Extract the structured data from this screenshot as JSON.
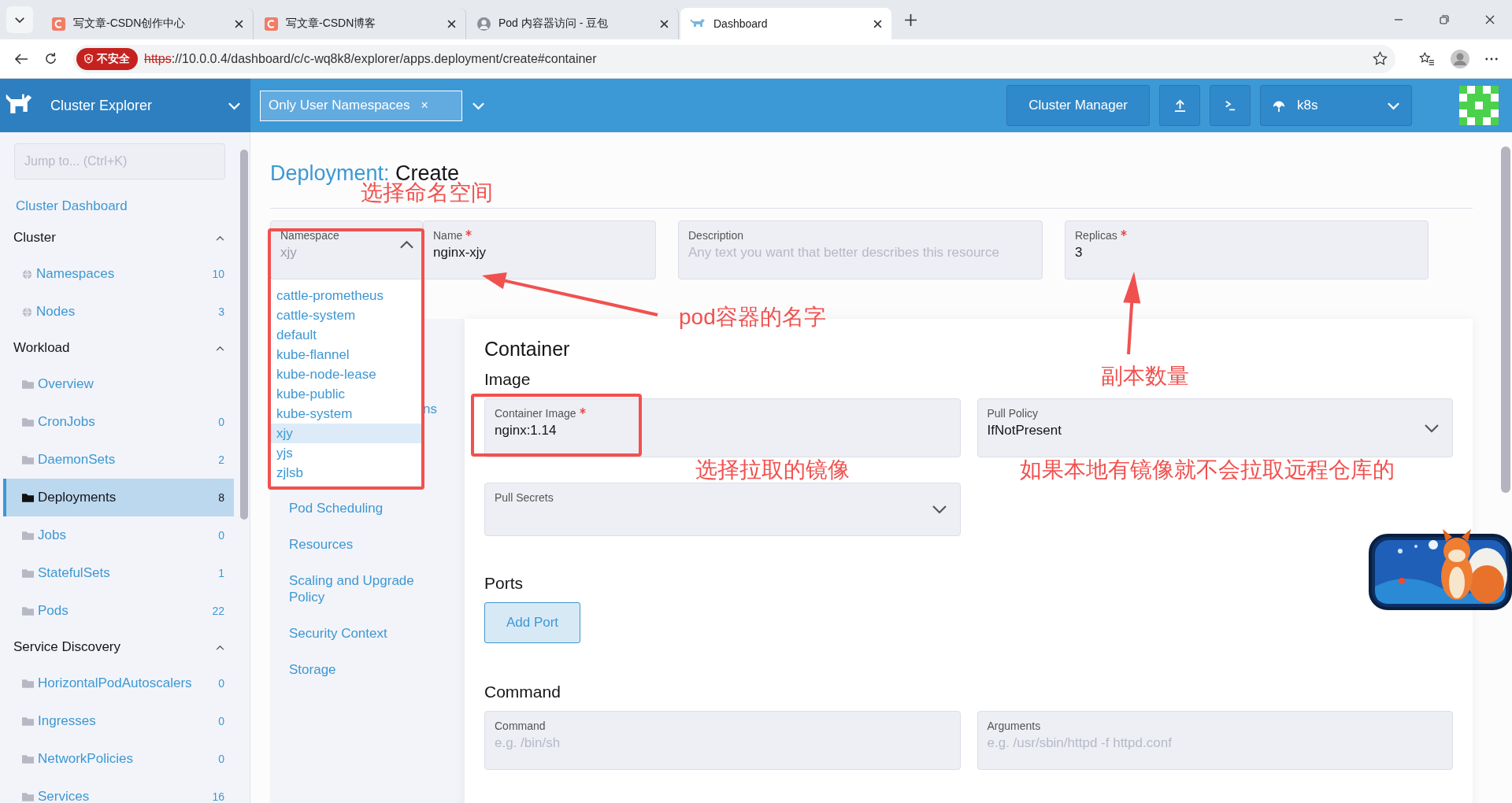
{
  "browser": {
    "tabs": [
      {
        "title": "写文章-CSDN创作中心",
        "selected": false,
        "kind": "csdn"
      },
      {
        "title": "写文章-CSDN博客",
        "selected": false,
        "kind": "csdn"
      },
      {
        "title": "Pod 内容器访问 - 豆包",
        "selected": false,
        "kind": "chat"
      },
      {
        "title": "Dashboard",
        "selected": true,
        "kind": "rancher"
      }
    ],
    "address": {
      "security_label": "不安全",
      "scheme": "https",
      "rest": "://10.0.0.4/dashboard/c/c-wq8k8/explorer/apps.deployment/create#container"
    }
  },
  "header": {
    "product": "Cluster Explorer",
    "namespace_chip": "Only User Namespaces",
    "chip_remove": "×",
    "cluster_manager": "Cluster Manager",
    "cluster": "k8s"
  },
  "sidebar": {
    "search_placeholder": "Jump to... (Ctrl+K)",
    "dashboard_link": "Cluster Dashboard",
    "groups": [
      {
        "title": "Cluster",
        "expanded": true,
        "items": [
          {
            "label": "Namespaces",
            "count": "10",
            "kind": "global",
            "selected": false
          },
          {
            "label": "Nodes",
            "count": "3",
            "kind": "global",
            "selected": false
          }
        ]
      },
      {
        "title": "Workload",
        "expanded": true,
        "items": [
          {
            "label": "Overview",
            "kind": "namespaced",
            "selected": false
          },
          {
            "label": "CronJobs",
            "count": "0",
            "kind": "namespaced",
            "selected": false
          },
          {
            "label": "DaemonSets",
            "count": "2",
            "kind": "namespaced",
            "selected": false
          },
          {
            "label": "Deployments",
            "count": "8",
            "kind": "namespaced",
            "selected": true
          },
          {
            "label": "Jobs",
            "count": "0",
            "kind": "namespaced",
            "selected": false
          },
          {
            "label": "StatefulSets",
            "count": "1",
            "kind": "namespaced",
            "selected": false
          },
          {
            "label": "Pods",
            "count": "22",
            "kind": "namespaced",
            "selected": false
          }
        ]
      },
      {
        "title": "Service Discovery",
        "expanded": true,
        "items": [
          {
            "label": "HorizontalPodAutoscalers",
            "count": "0",
            "kind": "namespaced",
            "selected": false
          },
          {
            "label": "Ingresses",
            "count": "0",
            "kind": "namespaced",
            "selected": false
          },
          {
            "label": "NetworkPolicies",
            "count": "0",
            "kind": "namespaced",
            "selected": false
          },
          {
            "label": "Services",
            "count": "16",
            "kind": "namespaced",
            "selected": false
          }
        ]
      }
    ]
  },
  "page": {
    "title_kind": "Deployment:",
    "title_action": "Create",
    "namespace": {
      "label": "Namespace",
      "value": "xjy",
      "expanded": true,
      "options": [
        {
          "label": "cattle-prometheus",
          "selected": false
        },
        {
          "label": "cattle-system",
          "selected": false
        },
        {
          "label": "default",
          "selected": false
        },
        {
          "label": "kube-flannel",
          "selected": false
        },
        {
          "label": "kube-node-lease",
          "selected": false
        },
        {
          "label": "kube-public",
          "selected": false
        },
        {
          "label": "kube-system",
          "selected": false
        },
        {
          "label": "xjy",
          "selected": true
        },
        {
          "label": "yjs",
          "selected": false
        },
        {
          "label": "zjlsb",
          "selected": false
        }
      ]
    },
    "fields": [
      {
        "label": "Name",
        "required": true,
        "value": "nginx-xjy"
      },
      {
        "label": "Description",
        "required": false,
        "placeholder": "Any text you want that better describes this resource"
      },
      {
        "label": "Replicas",
        "required": true,
        "value": "3"
      }
    ],
    "nav": [
      "ns",
      "Pod Scheduling",
      "Resources",
      "Scaling and Upgrade Policy",
      "Security Context",
      "Storage"
    ],
    "container": {
      "heading": "Container",
      "image_heading": "Image",
      "image_fields": [
        {
          "kind": "input",
          "label": "Container Image",
          "required": true,
          "value": "nginx:1.14"
        },
        {
          "kind": "select",
          "label": "Pull Policy",
          "required": false,
          "value": "IfNotPresent"
        }
      ],
      "pull_secrets": {
        "kind": "select",
        "label": "Pull Secrets",
        "required": false
      },
      "ports_heading": "Ports",
      "add_port": "Add Port",
      "command_heading": "Command",
      "command_fields": [
        {
          "label": "Command",
          "required": false,
          "placeholder": "e.g. /bin/sh"
        },
        {
          "label": "Arguments",
          "required": false,
          "placeholder": "e.g. /usr/sbin/httpd -f httpd.conf"
        }
      ]
    }
  },
  "annotations": [
    "选择命名空间",
    "pod容器的名字",
    "副本数量",
    "选择拉取的镜像",
    "如果本地有镜像就不会拉取远程仓库的"
  ]
}
